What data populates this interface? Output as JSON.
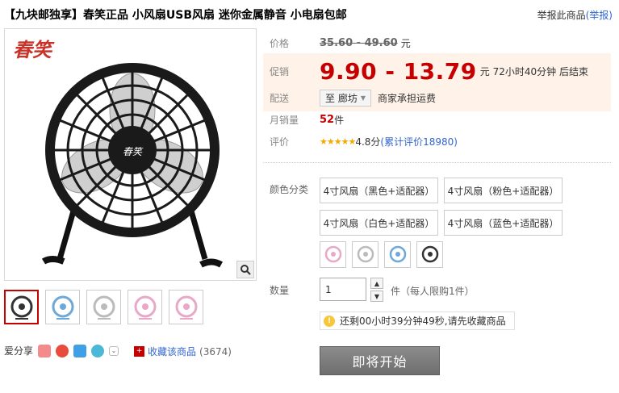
{
  "title": "【九块邮独享】春笑正品 小风扇USB风扇 迷你金属静音 小电扇包邮",
  "report": {
    "text": "举报此商品",
    "link": "(举报)"
  },
  "main_image": {
    "logo": "春笑",
    "zoom_icon": "magnifier-icon"
  },
  "thumbnails": [
    {
      "name": "thumb-black",
      "color": "#333333"
    },
    {
      "name": "thumb-blue",
      "color": "#6ea8d8"
    },
    {
      "name": "thumb-white",
      "color": "#cfcfcf"
    },
    {
      "name": "thumb-pink",
      "color": "#e8a8c8"
    },
    {
      "name": "thumb-pink2",
      "color": "#e8a8c8"
    }
  ],
  "share": {
    "label": "爱分享"
  },
  "favorite": {
    "label": "收藏该商品",
    "count": "(3674)"
  },
  "info": {
    "price_label": "价格",
    "old_price": "35.60 - 49.60",
    "yuan": "元",
    "promo_label": "促销",
    "promo_price": "9.90 - 13.79",
    "countdown": "元 72小时40分钟 后结束",
    "delivery_label": "配送",
    "delivery_to": "至 廊坊",
    "shipping": "商家承担运费",
    "sales_label": "月销量",
    "sales_value": "52",
    "sales_unit": "件",
    "rating_label": "评价",
    "stars": "★★★★★",
    "score": "4.8分",
    "reviews": "(累计评价18980)"
  },
  "sku": {
    "label": "颜色分类",
    "options": [
      "4寸风扇（黑色+适配器）",
      "4寸风扇（粉色+适配器）",
      "4寸风扇（白色+适配器）",
      "4寸风扇（蓝色+适配器）"
    ],
    "swatches": [
      "#e8a8c8",
      "#cfcfcf",
      "#6ea8d8",
      "#333333"
    ]
  },
  "quantity": {
    "label": "数量",
    "value": "1",
    "limit": "件（每人限购1件）"
  },
  "tip": "还剩00小时39分钟49秒,请先收藏商品",
  "buy_button": "即将开始",
  "colors": {
    "accent": "#c40000",
    "link": "#3366cc",
    "promo_bg": "#fff2e8"
  }
}
